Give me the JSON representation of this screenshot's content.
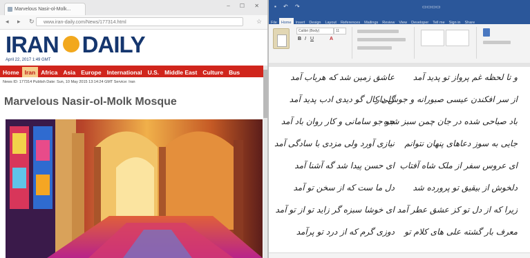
{
  "browser": {
    "tab_title": "Marvelous Nasir-ol-Molk...",
    "url": "www.iran-daily.com/News/177314.html",
    "logo_left": "IRAN",
    "logo_right": "DAILY",
    "date_line": "April 22, 2017 1:49 GMT",
    "nav_items": [
      "Home",
      "Iran",
      "Africa",
      "Asia",
      "Europe",
      "International",
      "U.S.",
      "Middle East",
      "Culture",
      "Bus"
    ],
    "active_nav": "Iran",
    "meta_line": "News ID: 177314    Publish Date: Sun, 10 May 2015 13:14:24 GMT    Service: Iran",
    "headline": "Marvelous Nasir-ol-Molk Mosque"
  },
  "word": {
    "ribbon_tabs": [
      "File",
      "Home",
      "Insert",
      "Design",
      "Layout",
      "References",
      "Mailings",
      "Review",
      "View",
      "Developer",
      "Tell me",
      "Sign in",
      "Share"
    ],
    "active_tab": "Home",
    "font_name": "Calibri (Body)",
    "font_size": "11",
    "poem_right": [
      "و تا لحظه غم پرواز تو پدید آمد",
      "از سر افکندن عیسی صبورانه و جوش دار",
      "باد صباحی شده در جان چمن سبز شده",
      "جایی به سوز دعاهای پنهان نتوانم",
      "ای عروس سفر از ملک شاه آفتاب",
      "دلخوش از بیقیق تو پرورده شد",
      "زیرا که از دل تو کز عشق عطر آمد",
      "معرف بار گشته علی های کلام تو"
    ],
    "poem_left": [
      "عاشق زمین شد که هرباب آمد",
      "گلی کال گو دیدی ادب پدید آمد",
      "جو جو سامانی و کار روان باد آمد",
      "نیازی آورد ولی مزدی با سادگی آمد",
      "ای حسن پیدا شد گه آشنا آمد",
      "دل ما ست که از سخن تو آمد",
      "ای خوشا سبزه گر زاید تو از تو آمد",
      "دوزی گرم که از درد تو پرآمد"
    ]
  }
}
